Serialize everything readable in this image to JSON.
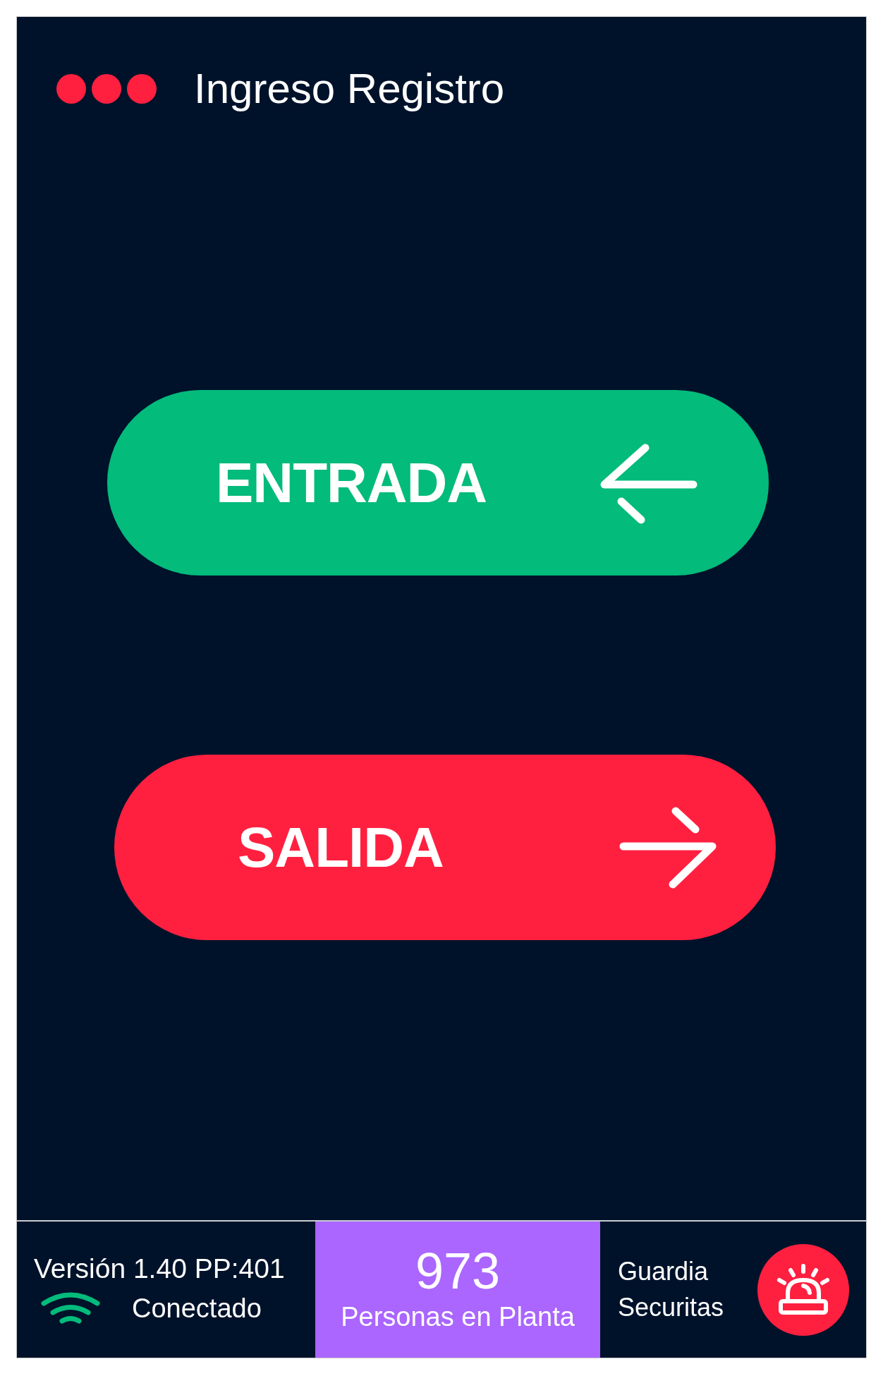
{
  "header": {
    "title": "Ingreso Registro"
  },
  "actions": [
    {
      "label": "ENTRADA",
      "kind": "entry"
    },
    {
      "label": "SALIDA",
      "kind": "exit"
    }
  ],
  "footer": {
    "version": "Versión 1.40 PP:401",
    "connection": {
      "status": "Conectado",
      "connected": true
    },
    "count": {
      "value": "973",
      "label": "Personas en Planta"
    },
    "guard": {
      "label": "Guardia Securitas"
    }
  }
}
